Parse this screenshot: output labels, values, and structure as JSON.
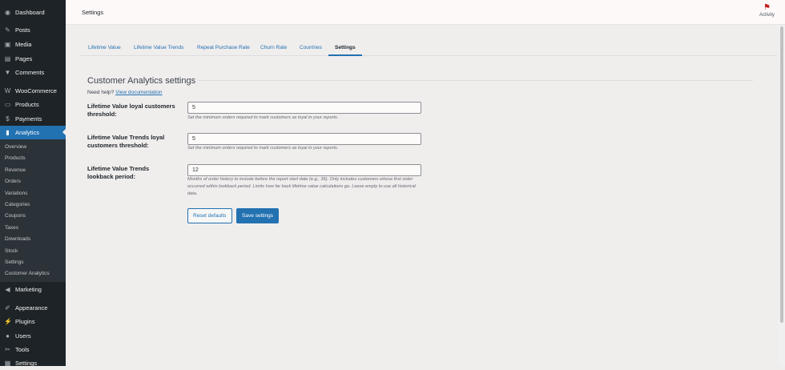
{
  "sidebar": {
    "items": [
      {
        "label": "Dashboard",
        "icon": "dashboard-icon",
        "g": "◉"
      },
      {
        "label": "Posts",
        "icon": "pin-icon",
        "g": "✎"
      },
      {
        "label": "Media",
        "icon": "media-icon",
        "g": "▣"
      },
      {
        "label": "Pages",
        "icon": "pages-icon",
        "g": "▤"
      },
      {
        "label": "Comments",
        "icon": "comment-icon",
        "g": "▼"
      },
      {
        "label": "WooCommerce",
        "icon": "woo-icon",
        "g": "W"
      },
      {
        "label": "Products",
        "icon": "products-icon",
        "g": "▭"
      },
      {
        "label": "Payments",
        "icon": "payments-icon",
        "g": "$"
      },
      {
        "label": "Analytics",
        "icon": "analytics-icon",
        "g": "▮"
      },
      {
        "label": "Marketing",
        "icon": "megaphone-icon",
        "g": "◀"
      },
      {
        "label": "Appearance",
        "icon": "brush-icon",
        "g": "✐"
      },
      {
        "label": "Plugins",
        "icon": "plugin-icon",
        "g": "⚡"
      },
      {
        "label": "Users",
        "icon": "users-icon",
        "g": "●"
      },
      {
        "label": "Tools",
        "icon": "wrench-icon",
        "g": "✂"
      },
      {
        "label": "Settings",
        "icon": "settings-icon",
        "g": "▦"
      }
    ],
    "submenu": [
      "Overview",
      "Products",
      "Revenue",
      "Orders",
      "Variations",
      "Categories",
      "Coupons",
      "Taxes",
      "Downloads",
      "Stock",
      "Settings",
      "Customer Analytics"
    ]
  },
  "header": {
    "title": "Settings",
    "activity": "Activity"
  },
  "tabs": [
    "Lifetime Value",
    "Lifetime Value Trends",
    "Repeat Purchase Rate",
    "Churn Rate",
    "Countries",
    "Settings"
  ],
  "main": {
    "title": "Customer Analytics settings",
    "help": "Need help?",
    "help_link": "View documentation",
    "fields": [
      {
        "label": "Lifetime Value loyal customers threshold:",
        "value": "5",
        "desc": "Set the minimum orders required to mark customers as loyal in your reports."
      },
      {
        "label": "Lifetime Value Trends loyal customers threshold:",
        "value": "5",
        "desc": "Set the minimum orders required to mark customers as loyal in your reports."
      },
      {
        "label": "Lifetime Value Trends lookback period:",
        "value": "12",
        "desc": "Months of order history to include before the report start date (e.g., 36). Only includes customers whose first order occurred within lookback period. Limits how far back lifetime value calculations go. Leave empty to use all historical data."
      }
    ],
    "reset": "Reset defaults",
    "save": "Save settings"
  },
  "colors": {
    "accent": "#2271b1",
    "sidebar": "#1d2327"
  }
}
